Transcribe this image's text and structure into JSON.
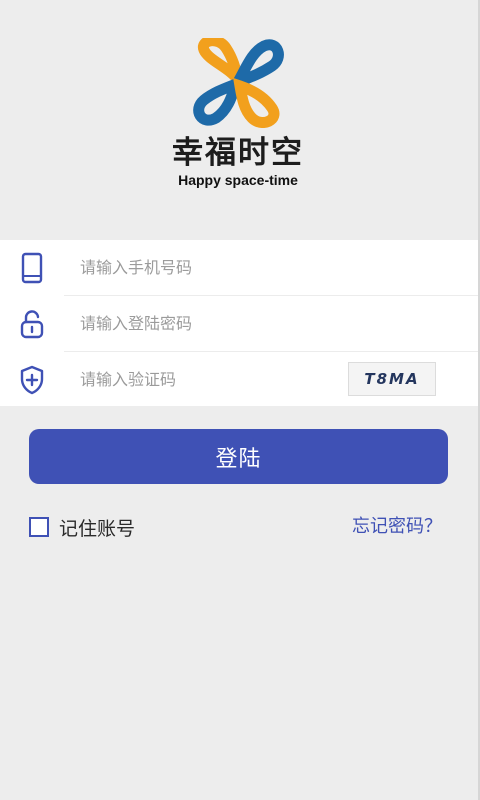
{
  "brand": {
    "name_cn": "幸福时空",
    "name_en": "Happy space-time",
    "colors": {
      "blue": "#1e6aa8",
      "orange": "#f2a01d"
    }
  },
  "form": {
    "phone": {
      "placeholder": "请输入手机号码",
      "icon": "phone-icon"
    },
    "password": {
      "placeholder": "请输入登陆密码",
      "icon": "lock-icon"
    },
    "captcha": {
      "placeholder": "请输入验证码",
      "icon": "shield-plus-icon",
      "code": "T8MA"
    }
  },
  "actions": {
    "login_label": "登陆",
    "remember_label": "记住账号",
    "remember_checked": false,
    "forgot_label": "忘记密码？"
  },
  "colors": {
    "accent": "#3f51b5",
    "background": "#ededed",
    "panel": "#ffffff"
  }
}
